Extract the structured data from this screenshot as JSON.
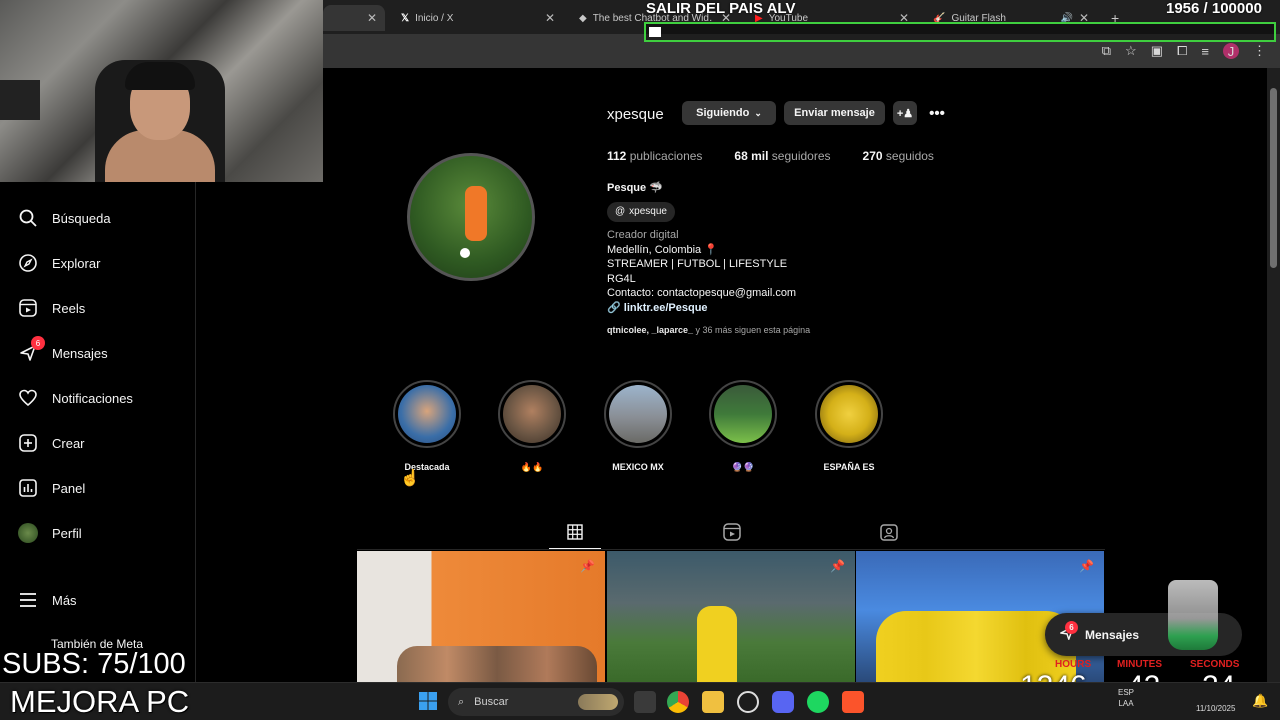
{
  "browser": {
    "tabs": [
      {
        "title": "",
        "active": true
      },
      {
        "title": "Inicio / X",
        "icon": "x-logo-icon"
      },
      {
        "title": "The best Chatbot and Wid…",
        "icon": "chatbot-icon"
      },
      {
        "title": "YouTube",
        "icon": "youtube-icon"
      },
      {
        "title": "Guitar Flash",
        "icon": "guitar-icon"
      }
    ],
    "new_tab_label": "+",
    "profile_initial": "J"
  },
  "overlay": {
    "title": "SALIR DEL PAIS ALV",
    "counter": "1956  / 100000",
    "goal_progress": 0.0196,
    "subs": "SUBS: 75/100",
    "mejora": "MEJORA PC",
    "timer": {
      "labels": [
        "HOURS",
        "MINUTES",
        "SECONDS"
      ],
      "values": [
        "1246",
        "42",
        "24"
      ]
    }
  },
  "sidebar": {
    "items": [
      {
        "label": "Búsqueda",
        "icon": "search-icon"
      },
      {
        "label": "Explorar",
        "icon": "compass-icon"
      },
      {
        "label": "Reels",
        "icon": "reels-icon"
      },
      {
        "label": "Mensajes",
        "icon": "messenger-icon",
        "badge": "6"
      },
      {
        "label": "Notificaciones",
        "icon": "heart-icon"
      },
      {
        "label": "Crear",
        "icon": "plus-square-icon"
      },
      {
        "label": "Panel",
        "icon": "dashboard-icon"
      },
      {
        "label": "Perfil",
        "icon": "avatar-icon"
      },
      {
        "label": "Más",
        "icon": "menu-icon"
      }
    ],
    "also_from_meta": "También de Meta"
  },
  "profile": {
    "username": "xpesque",
    "buttons": {
      "following": "Siguiendo",
      "message": "Enviar mensaje"
    },
    "stats": {
      "posts_count": "112",
      "posts_label": "publicaciones",
      "followers_count": "68 mil",
      "followers_label": "seguidores",
      "following_count": "270",
      "following_label": "seguidos"
    },
    "bio": {
      "name": "Pesque 🦈",
      "threads_handle": "xpesque",
      "category": "Creador digital",
      "line1": "Medellín, Colombia 📍",
      "line2": "STREAMER | FUTBOL | LIFESTYLE",
      "line3": "RG4L",
      "line4": "Contacto: contactopesque@gmail.com",
      "link": "linktr.ee/Pesque"
    },
    "followed_by_names": "qtnicolee, _laparce_",
    "followed_by_rest": " y 36 más siguen esta página",
    "highlights": [
      {
        "label": "Destacada",
        "color": "#4a6ea8"
      },
      {
        "label": "🔥🔥",
        "color": "#6b5644"
      },
      {
        "label": "MEXICO MX",
        "color": "#8a8f96"
      },
      {
        "label": "🔮🔮",
        "color": "#3f7a3a"
      },
      {
        "label": "ESPAÑA ES",
        "color": "#d4b018"
      }
    ]
  },
  "messages_pill": {
    "label": "Mensajes",
    "badge": "6"
  },
  "taskbar": {
    "search_placeholder": "Buscar",
    "lang_top": "ESP",
    "lang_bottom": "LAA",
    "date": "11/10/2025"
  }
}
